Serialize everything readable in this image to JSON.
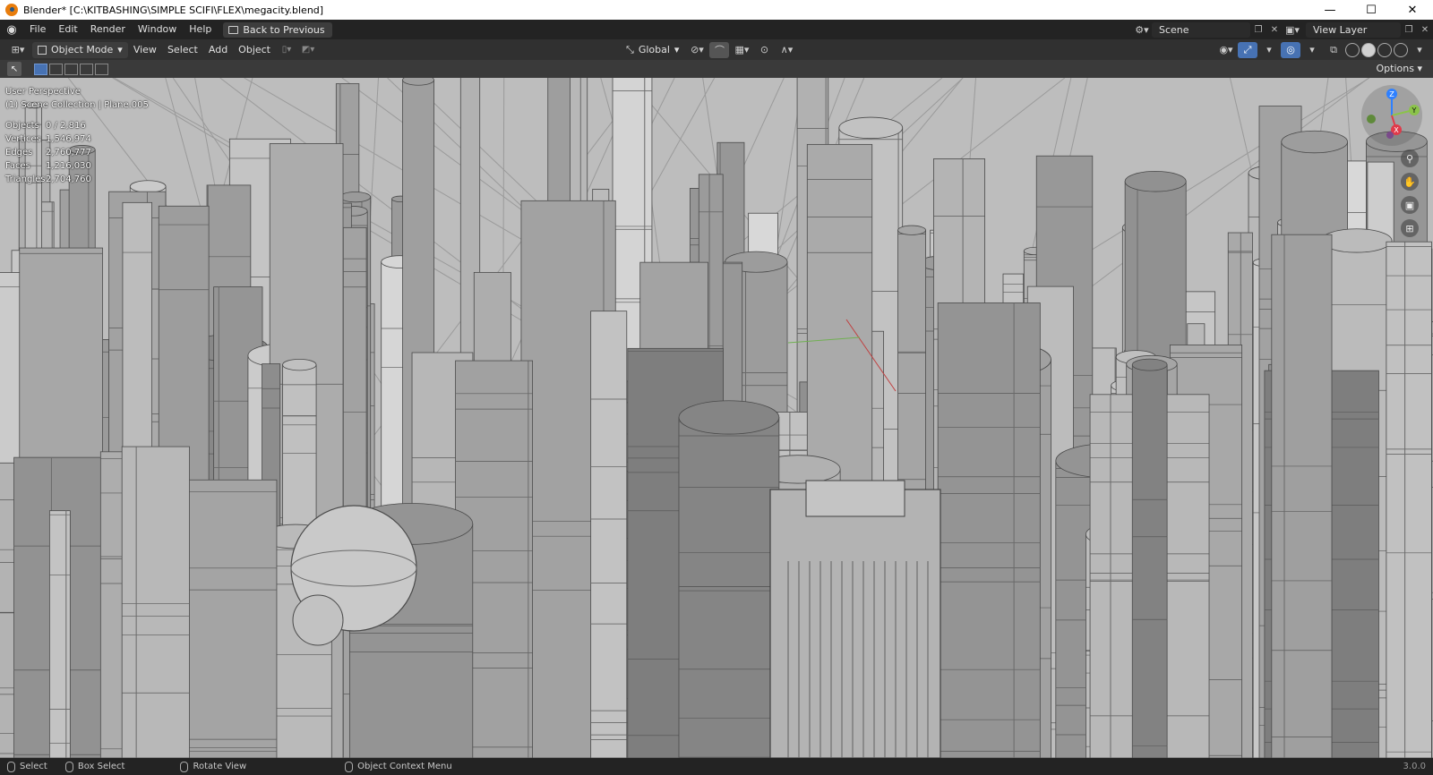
{
  "window": {
    "title": "Blender* [C:\\KITBASHING\\SIMPLE SCIFI\\FLEX\\megacity.blend]",
    "minimize": "—",
    "maximize": "☐",
    "close": "✕"
  },
  "topbar": {
    "menus": [
      "File",
      "Edit",
      "Render",
      "Window",
      "Help"
    ],
    "back_button": "Back to Previous",
    "scene": "Scene",
    "view_layer": "View Layer"
  },
  "viewport_header": {
    "mode": "Object Mode",
    "menus": [
      "View",
      "Select",
      "Add",
      "Object"
    ],
    "transform_orientation": "Global",
    "options": "Options"
  },
  "viewport": {
    "view_name": "User Perspective",
    "collection": "(1) Scene Collection | Plane.005",
    "stats": [
      {
        "label": "Objects",
        "value": "0 / 2,816"
      },
      {
        "label": "Vertices",
        "value": "1,546,974"
      },
      {
        "label": "Edges",
        "value": "2,760,777"
      },
      {
        "label": "Faces",
        "value": "1,216,030"
      },
      {
        "label": "Triangles",
        "value": "2,704,760"
      }
    ],
    "gizmo_axes": {
      "z": "Z",
      "y": "Y",
      "x": "X"
    }
  },
  "statusbar": {
    "select": "Select",
    "box_select": "Box Select",
    "rotate_view": "Rotate View",
    "context_menu": "Object Context Menu",
    "version": "3.0.0"
  },
  "colors": {
    "accent": "#4772b3",
    "background": "#1d1d1d",
    "header": "#303030",
    "axis_x": "#e03a4a",
    "axis_y": "#8bc34a",
    "axis_z": "#2e80ff"
  }
}
